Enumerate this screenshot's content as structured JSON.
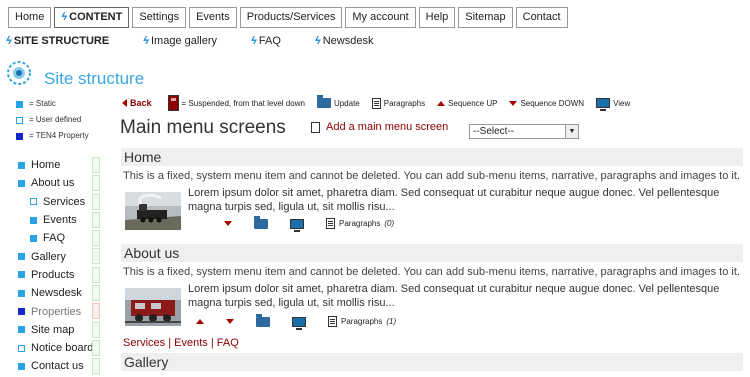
{
  "topnav": [
    {
      "label": "Home"
    },
    {
      "label": "CONTENT",
      "active": true
    },
    {
      "label": "Settings"
    },
    {
      "label": "Events"
    },
    {
      "label": "Products/Services"
    },
    {
      "label": "My account"
    },
    {
      "label": "Help"
    },
    {
      "label": "Sitemap"
    },
    {
      "label": "Contact"
    }
  ],
  "subnav": [
    {
      "label": "SITE STRUCTURE",
      "active": true
    },
    {
      "label": "Image gallery"
    },
    {
      "label": "FAQ"
    },
    {
      "label": "Newsdesk"
    }
  ],
  "site_title": "Site structure",
  "legend": {
    "static": "= Static",
    "user": "= User defined",
    "ten4": "= TEN4 Property"
  },
  "sidebar": [
    {
      "label": "Home",
      "type": "static"
    },
    {
      "label": "About us",
      "type": "static"
    },
    {
      "label": "Services",
      "type": "user",
      "sub": true
    },
    {
      "label": "Events",
      "type": "static",
      "sub": true
    },
    {
      "label": "FAQ",
      "type": "static",
      "sub": true
    },
    {
      "label": "Gallery",
      "type": "static"
    },
    {
      "label": "Products",
      "type": "static"
    },
    {
      "label": "Newsdesk",
      "type": "static"
    },
    {
      "label": "Properties",
      "type": "ten4"
    },
    {
      "label": "Site map",
      "type": "static"
    },
    {
      "label": "Notice board",
      "type": "user"
    },
    {
      "label": "Contact us",
      "type": "static"
    }
  ],
  "toolbar": {
    "back": "Back",
    "suspended": "= Suspended, from that level down",
    "update": "Update",
    "paragraphs": "Paragraphs",
    "seq_up": "Sequence UP",
    "seq_down": "Sequence DOWN",
    "view": "View"
  },
  "main": {
    "heading": "Main menu screens",
    "add_link": "Add a main menu screen",
    "select_value": "--Select--"
  },
  "sections": [
    {
      "title": "Home",
      "desc": "This is a fixed, system menu item and cannot be deleted. You can add sub-menu items, narrative, paragraphs and images to it.",
      "lorem": "Lorem ipsum dolor sit amet, pharetra diam. Sed consequat ut curabitur neque augue donec. Vel pellentesque magna turpis sed, ligula ut, sit mollis risu...",
      "paragraphs_label": "Paragraphs",
      "paragraphs_count": "(0)"
    },
    {
      "title": "About us",
      "desc": "This is a fixed, system menu item and cannot be deleted. You can add sub-menu items, narrative, paragraphs and images to it.",
      "lorem": "Lorem ipsum dolor sit amet, pharetra diam. Sed consequat ut curabitur neque augue donec. Vel pellentesque magna turpis sed, ligula ut, sit mollis risu...",
      "paragraphs_label": "Paragraphs",
      "paragraphs_count": "(1)",
      "sublinks": "Services | Events | FAQ"
    },
    {
      "title": "Gallery"
    }
  ],
  "colors": {
    "accent": "#3aa8e0",
    "link": "#8b0000",
    "static": "#29a3e6",
    "ten4": "#1528c8"
  }
}
